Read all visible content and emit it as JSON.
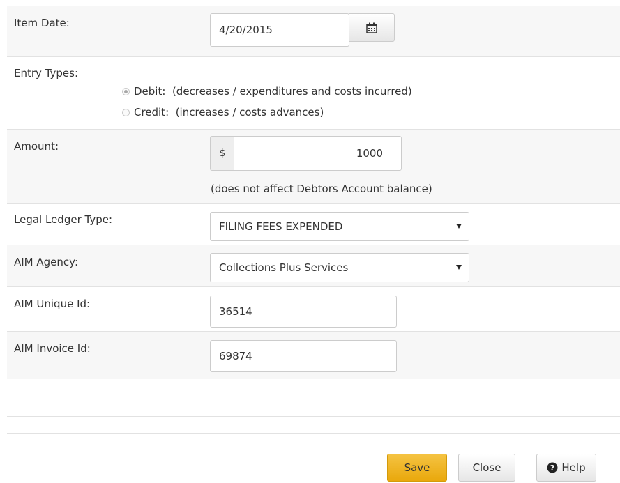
{
  "form": {
    "item_date": {
      "label": "Item Date:",
      "value": "4/20/2015"
    },
    "entry_types": {
      "label": "Entry Types:",
      "debit_label": "Debit:  (decreases / expenditures and costs incurred)",
      "credit_label": "Credit:  (increases / costs advances)",
      "selected": "debit"
    },
    "amount": {
      "label": "Amount:",
      "currency": "$",
      "value": "1000",
      "note": "(does not affect Debtors Account balance)"
    },
    "legal_ledger_type": {
      "label": "Legal Ledger Type:",
      "value": "FILING FEES EXPENDED"
    },
    "aim_agency": {
      "label": "AIM Agency:",
      "value": "Collections Plus Services"
    },
    "aim_unique_id": {
      "label": "AIM Unique Id:",
      "value": "36514"
    },
    "aim_invoice_id": {
      "label": "AIM Invoice Id:",
      "value": "69874"
    }
  },
  "footer": {
    "save_label": "Save",
    "close_label": "Close",
    "help_label": "Help"
  },
  "icons": {
    "calendar": "calendar-icon",
    "help": "question-circle-icon"
  },
  "colors": {
    "primary_button": "#f0b323",
    "row_alt": "#f7f7f7",
    "border": "#cccccc"
  }
}
